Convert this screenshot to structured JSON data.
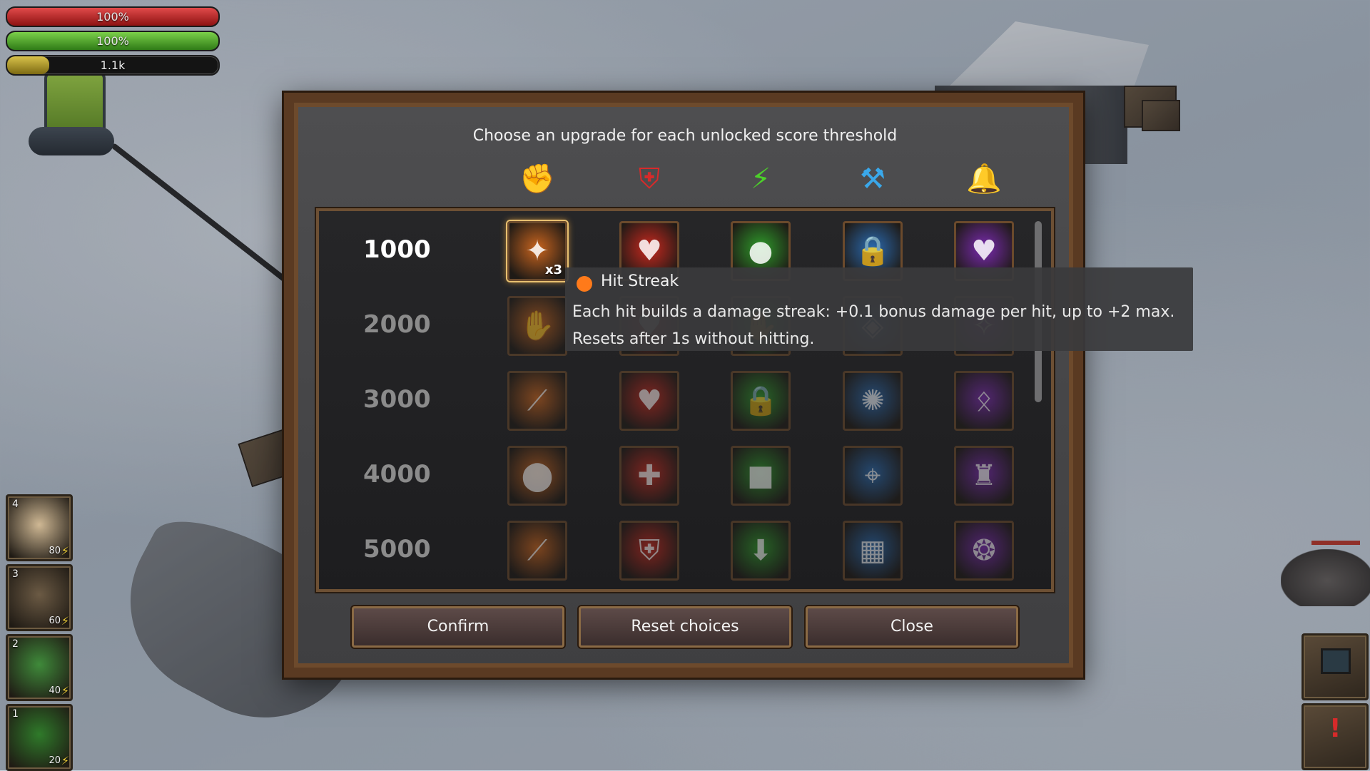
{
  "hud": {
    "health": {
      "label": "100%",
      "level": 1.0
    },
    "shield": {
      "label": "100%",
      "level": 1.0
    },
    "energy": {
      "label": "1.1k",
      "level": 0.2
    }
  },
  "abilities": [
    {
      "key": "4",
      "cost": "80",
      "icon": "angel-cat-icon",
      "color": "#cfb894"
    },
    {
      "key": "3",
      "cost": "60",
      "icon": "mousetrap-icon",
      "color": "#6b5a44"
    },
    {
      "key": "2",
      "cost": "40",
      "icon": "green-orb-icon",
      "color": "#3f8a3a"
    },
    {
      "key": "1",
      "cost": "20",
      "icon": "lightning-field-icon",
      "color": "#2f7a2a"
    }
  ],
  "dialog": {
    "title": "Choose an upgrade for each unlocked score threshold",
    "categories": [
      {
        "icon": "fist-icon",
        "glyph": "✊",
        "color": "#f0a020"
      },
      {
        "icon": "shield-plus-icon",
        "glyph": "⛨",
        "color": "#d82a2a"
      },
      {
        "icon": "lightning-icon",
        "glyph": "⚡",
        "color": "#4ccf2a"
      },
      {
        "icon": "tools-icon",
        "glyph": "⚒",
        "color": "#3aa8ea"
      },
      {
        "icon": "bell-icon",
        "glyph": "🔔",
        "color": "#b04ae0"
      }
    ],
    "rows": [
      {
        "threshold": "1000",
        "unlocked": true
      },
      {
        "threshold": "2000",
        "unlocked": false
      },
      {
        "threshold": "3000",
        "unlocked": false
      },
      {
        "threshold": "4000",
        "unlocked": false
      },
      {
        "threshold": "5000",
        "unlocked": false
      }
    ],
    "tile_colors": [
      "#c8641e",
      "#c8281e",
      "#2e9a2a",
      "#2a6ab0",
      "#7a2ab0"
    ],
    "tile_icons": [
      [
        "hit-streak-icon",
        "burning-heart-icon",
        "green-orb-hand-icon",
        "blue-lock-icon",
        "purple-heart-icon"
      ],
      [
        "orange-paw-icon",
        "red-heart-hand-icon",
        "green-hand-icon",
        "blue-shield-icon",
        "purple-glow-icon"
      ],
      [
        "orange-slash-icon",
        "heart-ring-icon",
        "green-padlock-icon",
        "blue-burst-icon",
        "purple-rune-icon"
      ],
      [
        "cannon-icon",
        "red-pillar-icon",
        "green-box-icon",
        "blue-turret-icon",
        "purple-tower-icon"
      ],
      [
        "orange-blade-icon",
        "red-shield-icon",
        "green-arrow-icon",
        "blue-crate-icon",
        "purple-swirl-icon"
      ]
    ],
    "tile_glyphs": [
      [
        "✦",
        "♥",
        "●",
        "🔒",
        "♥"
      ],
      [
        "✋",
        "♥",
        "✋",
        "◈",
        "✧"
      ],
      [
        "⟋",
        "♥",
        "🔒",
        "✺",
        "ᛟ"
      ],
      [
        "⬤",
        "✚",
        "■",
        "⌖",
        "♜"
      ],
      [
        "⟋",
        "⛨",
        "⬇",
        "▦",
        "❂"
      ]
    ],
    "selected_tile_badge": "x3",
    "buttons": {
      "confirm": "Confirm",
      "reset": "Reset choices",
      "close": "Close"
    }
  },
  "tooltip": {
    "name": "Hit Streak",
    "color": "#ff7a1a",
    "description_line1": "Each hit builds a damage streak: +0.1 bonus damage per hit, up to +2 max.",
    "description_line2": "Resets after 1s without hitting."
  }
}
